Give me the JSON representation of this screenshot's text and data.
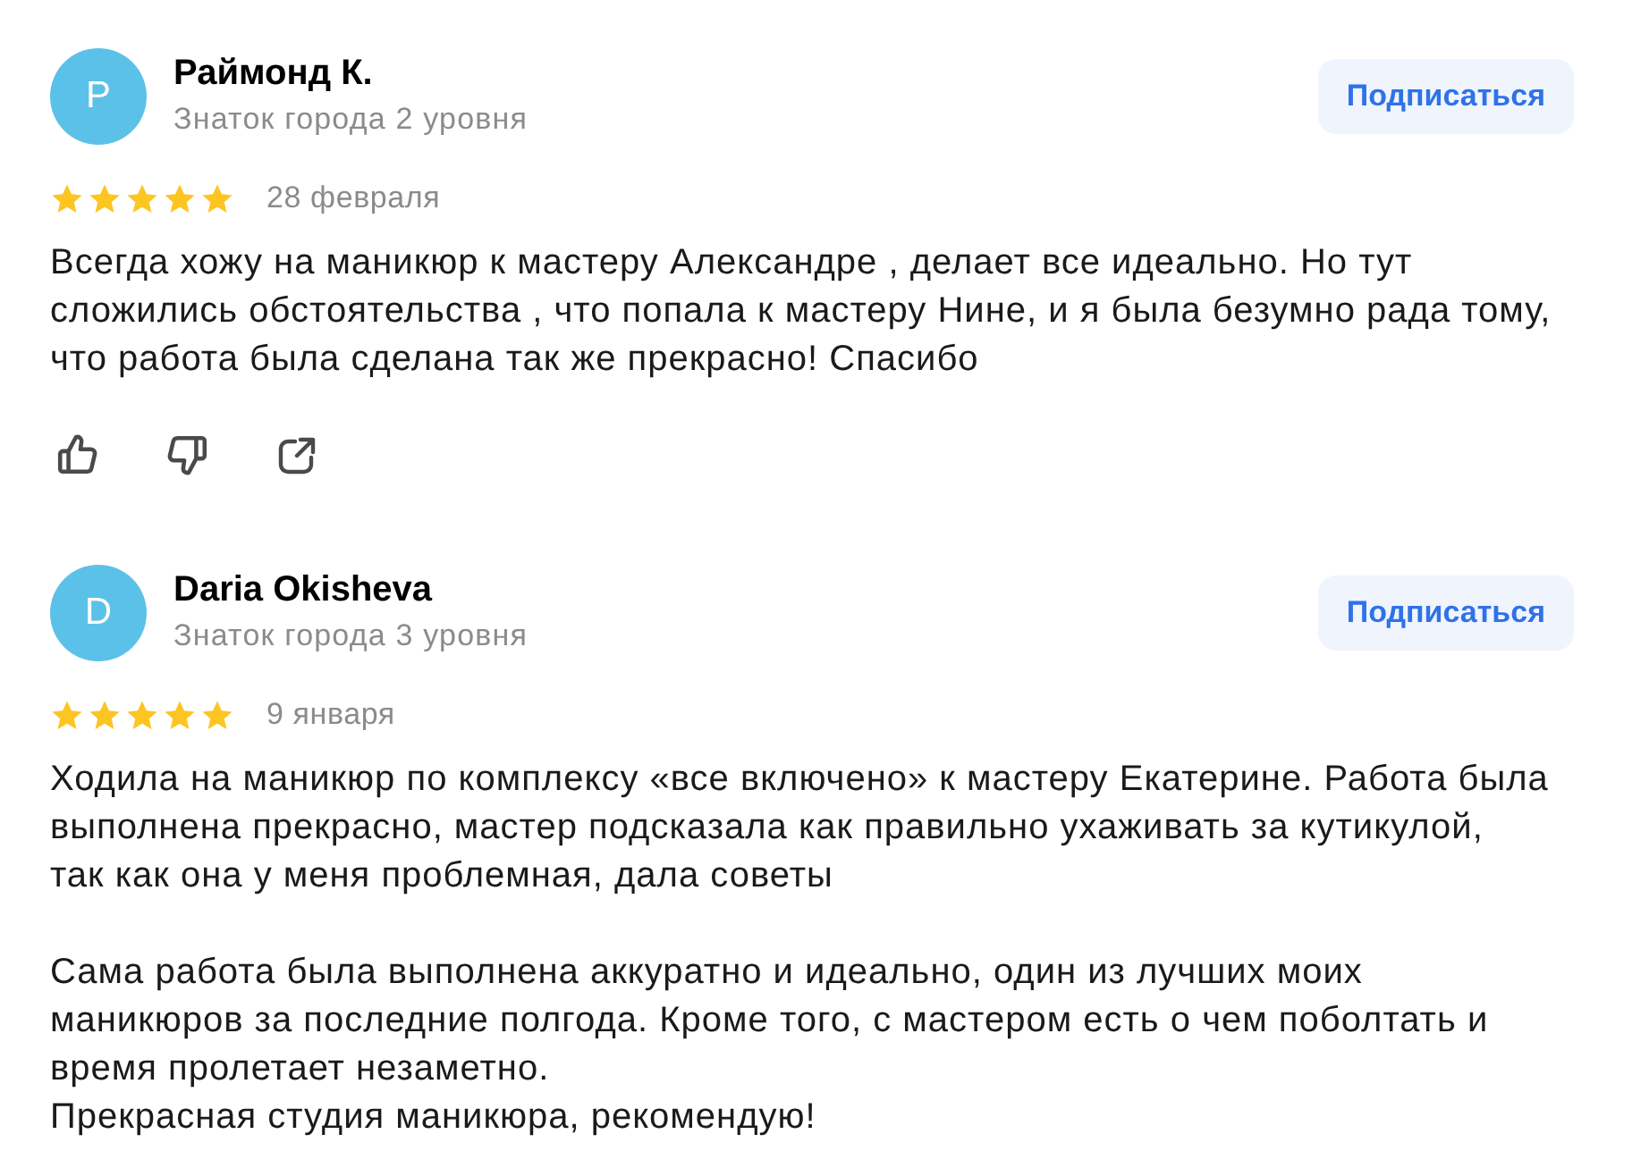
{
  "reviews": [
    {
      "author": {
        "initial": "Р",
        "name": "Раймонд К.",
        "level": "Знаток города 2 уровня"
      },
      "subscribe_button": "Подписаться",
      "stars": 5,
      "date": "28 февраля",
      "text": "Всегда хожу на маникюр к мастеру Александре , делает все идеально. Но тут\nсложились обстоятельства , что попала к мастеру Нине, и я была безумно рада тому,\nчто работа была сделана так же прекрасно! Спасибо",
      "actions": [
        {
          "kind": "like"
        },
        {
          "kind": "dislike"
        },
        {
          "kind": "share"
        }
      ]
    },
    {
      "author": {
        "initial": "D",
        "name": "Daria Okisheva",
        "level": "Знаток города 3 уровня"
      },
      "subscribe_button": "Подписаться",
      "stars": 5,
      "date": "9 января",
      "text": "Ходила на маникюр по комплексу «все включено» к мастеру Екатерине. Работа была\nвыполнена прекрасно, мастер подсказала как правильно ухаживать за кутикулой,\nтак как она у меня проблемная, дала советы\n\nСама работа была выполнена аккуратно и идеально, один из лучших моих\nманикюров за последние полгода. Кроме того, с мастером есть о чем поболтать и\nвремя пролетает незаметно.\nПрекрасная студия маникюра, рекомендую!"
    }
  ]
}
